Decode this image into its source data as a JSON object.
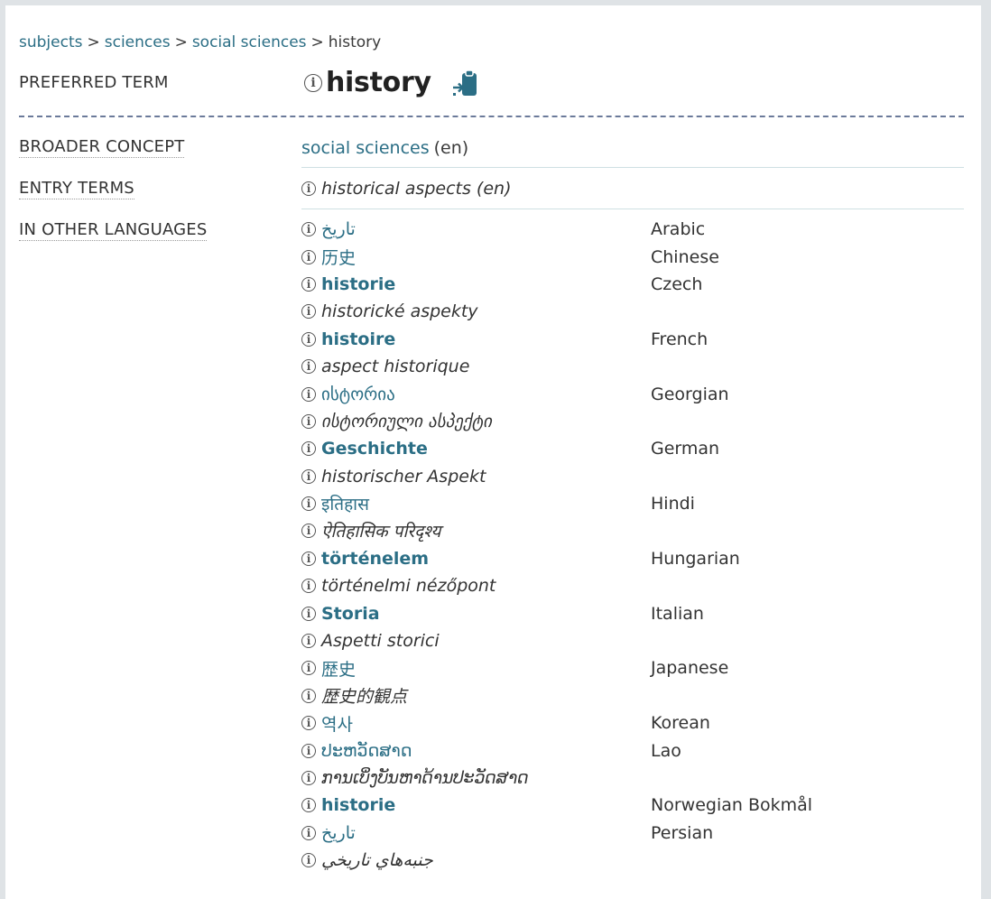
{
  "breadcrumb": {
    "items": [
      "subjects",
      "sciences",
      "social sciences"
    ],
    "current": "history",
    "separator": ">"
  },
  "labels": {
    "preferred": "PREFERRED TERM",
    "broader": "BROADER CONCEPT",
    "entry": "ENTRY TERMS",
    "other_languages": "IN OTHER LANGUAGES"
  },
  "preferred_term": {
    "label": "history",
    "info_icon": "info-icon",
    "copy_icon": "copy-to-clipboard-icon"
  },
  "broader_concept": {
    "label": "social sciences",
    "lang": "(en)"
  },
  "entry_terms": [
    {
      "label": "historical aspects (en)"
    }
  ],
  "colors": {
    "link": "#2b6e85",
    "dash": "#6b7a9a",
    "divider": "#cfe0e3"
  },
  "other_languages": [
    {
      "term": "تاريخ",
      "kind": "pref",
      "bold": false,
      "lang": "Arabic"
    },
    {
      "term": "历史",
      "kind": "pref",
      "bold": false,
      "lang": "Chinese"
    },
    {
      "term": "historie",
      "kind": "pref",
      "bold": true,
      "lang": "Czech"
    },
    {
      "term": "historické aspekty",
      "kind": "alt",
      "bold": false,
      "lang": ""
    },
    {
      "term": "histoire",
      "kind": "pref",
      "bold": true,
      "lang": "French"
    },
    {
      "term": "aspect historique",
      "kind": "alt",
      "bold": false,
      "lang": ""
    },
    {
      "term": "ისტორია",
      "kind": "pref",
      "bold": false,
      "lang": "Georgian"
    },
    {
      "term": "ისტორიული ასპექტი",
      "kind": "alt",
      "bold": false,
      "lang": ""
    },
    {
      "term": "Geschichte",
      "kind": "pref",
      "bold": true,
      "lang": "German"
    },
    {
      "term": "historischer Aspekt",
      "kind": "alt",
      "bold": false,
      "lang": ""
    },
    {
      "term": "इतिहास",
      "kind": "pref",
      "bold": false,
      "lang": "Hindi"
    },
    {
      "term": "ऐतिहासिक परिदृश्य",
      "kind": "alt",
      "bold": false,
      "lang": ""
    },
    {
      "term": "történelem",
      "kind": "pref",
      "bold": true,
      "lang": "Hungarian"
    },
    {
      "term": "történelmi nézőpont",
      "kind": "alt",
      "bold": false,
      "lang": ""
    },
    {
      "term": "Storia",
      "kind": "pref",
      "bold": true,
      "lang": "Italian"
    },
    {
      "term": "Aspetti storici",
      "kind": "alt",
      "bold": false,
      "lang": ""
    },
    {
      "term": "歴史",
      "kind": "pref",
      "bold": false,
      "lang": "Japanese"
    },
    {
      "term": "歴史的観点",
      "kind": "alt",
      "bold": false,
      "lang": ""
    },
    {
      "term": "역사",
      "kind": "pref",
      "bold": false,
      "lang": "Korean"
    },
    {
      "term": "ປະຫວັດສາດ",
      "kind": "pref",
      "bold": false,
      "lang": "Lao"
    },
    {
      "term": "ການເບິ່ງບັນຫາດ້ານປະວັດສາດ",
      "kind": "alt",
      "bold": false,
      "lang": ""
    },
    {
      "term": "historie",
      "kind": "pref",
      "bold": true,
      "lang": "Norwegian Bokmål"
    },
    {
      "term": "تاريخ",
      "kind": "pref",
      "bold": false,
      "lang": "Persian"
    },
    {
      "term": "جنبه‌هاي تاريخي",
      "kind": "alt",
      "bold": false,
      "lang": ""
    }
  ]
}
